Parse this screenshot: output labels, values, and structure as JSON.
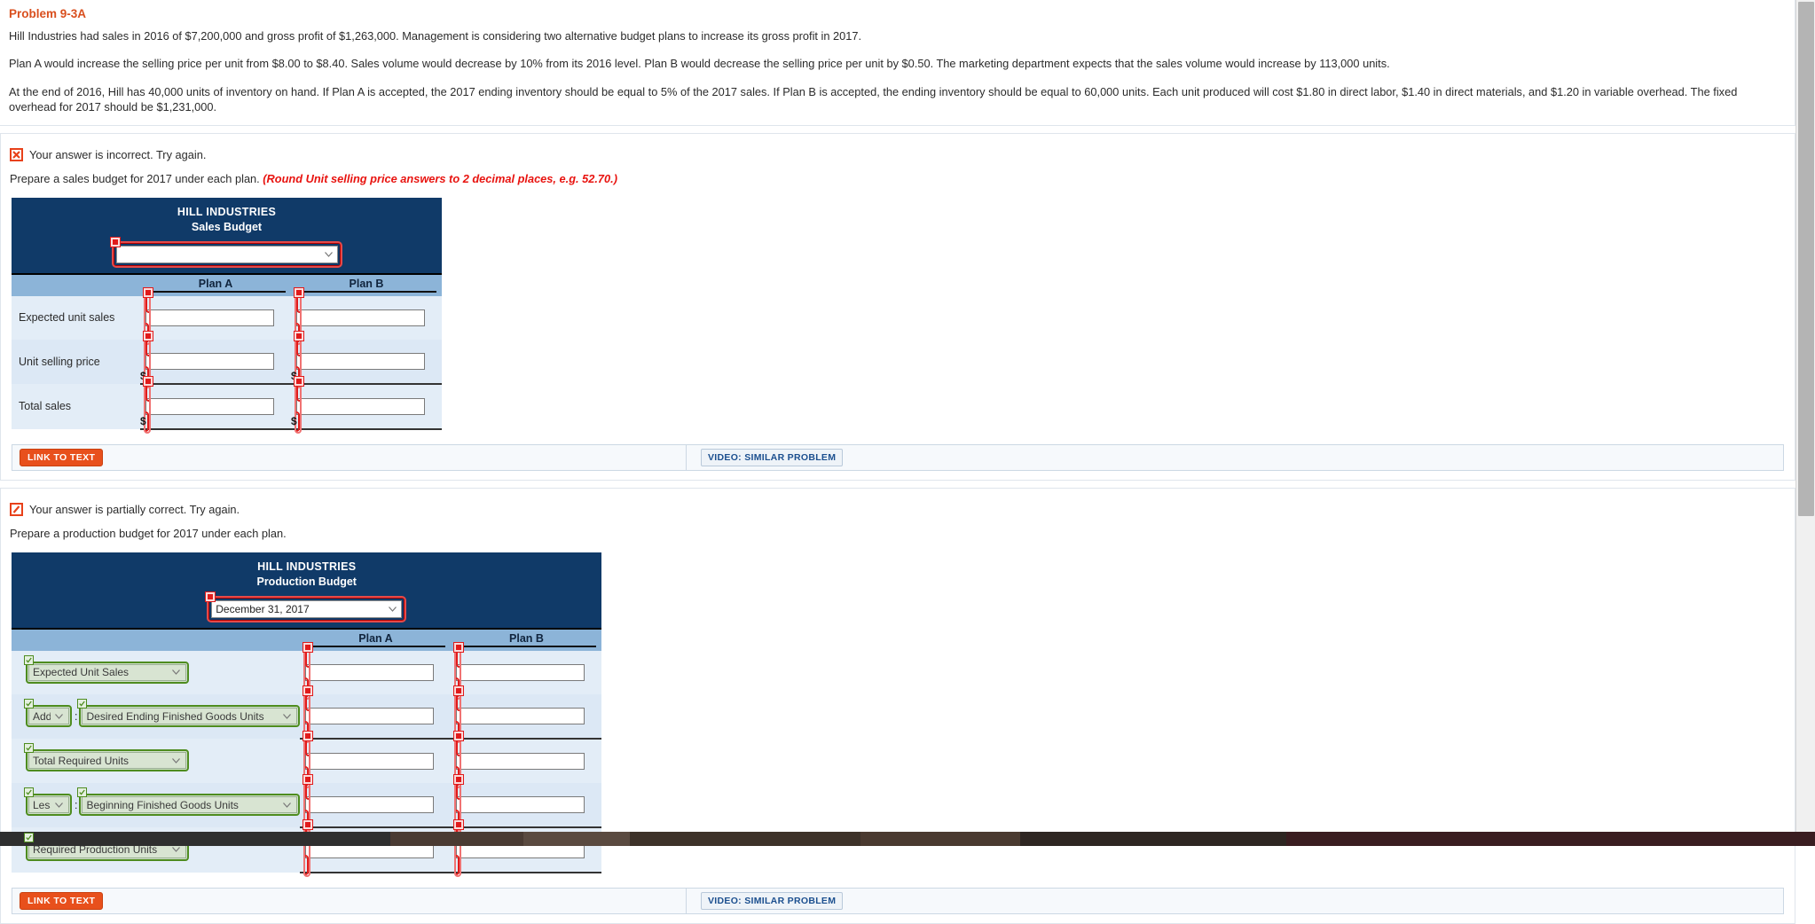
{
  "problem": {
    "title": "Problem 9-3A",
    "paragraphs": [
      "Hill Industries had sales in 2016 of $7,200,000 and gross profit of $1,263,000. Management is considering two alternative budget plans to increase its gross profit in 2017.",
      "Plan A would increase the selling price per unit from $8.00 to $8.40. Sales volume would decrease by 10% from its 2016 level. Plan B would decrease the selling price per unit by $0.50. The marketing department expects that the sales volume would increase by 113,000 units.",
      "At the end of 2016, Hill has 40,000 units of inventory on hand. If Plan A is accepted, the 2017 ending inventory should be equal to 5% of the 2017 sales. If Plan B is accepted, the ending inventory should be equal to 60,000 units. Each unit produced will cost $1.80 in direct labor, $1.40 in direct materials, and $1.20 in variable overhead. The fixed overhead for 2017 should be $1,231,000."
    ]
  },
  "colors": {
    "title_orange": "#d94f1e",
    "header_navy": "#103a68",
    "plan_header_blue": "#8cb4d8",
    "row_blue": "#e3edf7",
    "error_red": "#e01b1b",
    "correct_green": "#4e8c1f",
    "hint_red": "#e8130f",
    "link_button_orange": "#e8501c"
  },
  "section_sales": {
    "status_icon": "error-x-icon",
    "status_text": "Your answer is incorrect.  Try again.",
    "instruction": "Prepare a sales budget for 2017 under each plan.",
    "instruction_hint": "(Round Unit selling price answers to 2 decimal places, e.g. 52.70.)",
    "table": {
      "company": "HILL INDUSTRIES",
      "budget_name": "Sales Budget",
      "period_select": {
        "value": "",
        "placeholder": "",
        "icon": "chevron-down-icon",
        "state": "error"
      },
      "columns": [
        "Plan A",
        "Plan B"
      ],
      "rows": [
        {
          "label": "Expected unit sales",
          "prefix": "",
          "plan_a": "",
          "plan_b": "",
          "underline": false
        },
        {
          "label": "Unit selling price",
          "prefix": "$",
          "plan_a": "",
          "plan_b": "",
          "underline": true
        },
        {
          "label": "Total sales",
          "prefix": "$",
          "plan_a": "",
          "plan_b": "",
          "underline": true
        }
      ]
    },
    "footer": {
      "link_to_text": "LINK TO TEXT",
      "video": "VIDEO: SIMILAR PROBLEM"
    }
  },
  "section_production": {
    "status_icon": "partial-slash-icon",
    "status_text": "Your answer is partially correct.  Try again.",
    "instruction": "Prepare a production budget for 2017 under each plan.",
    "instruction_hint": "",
    "table": {
      "company": "HILL INDUSTRIES",
      "budget_name": "Production Budget",
      "period_select": {
        "value": "December 31, 2017",
        "icon": "chevron-down-icon",
        "state": "error"
      },
      "columns": [
        "Plan A",
        "Plan B"
      ],
      "rows": [
        {
          "op_select": null,
          "line_select": "Expected Unit Sales",
          "plan_a": "",
          "plan_b": "",
          "underline": false
        },
        {
          "op_select": "Add",
          "line_select": "Desired Ending Finished Goods Units",
          "plan_a": "",
          "plan_b": "",
          "underline": true
        },
        {
          "op_select": null,
          "line_select": "Total Required Units",
          "plan_a": "",
          "plan_b": "",
          "underline": false
        },
        {
          "op_select": "Less",
          "line_select": "Beginning Finished Goods Units",
          "plan_a": "",
          "plan_b": "",
          "underline": true
        },
        {
          "op_select": null,
          "line_select": "Required Production Units",
          "plan_a": "",
          "plan_b": "",
          "underline": true
        }
      ]
    },
    "footer": {
      "link_to_text": "LINK TO TEXT",
      "video": "VIDEO: SIMILAR PROBLEM"
    }
  },
  "scrollbar": {
    "icon": "scrollbar-thumb"
  }
}
